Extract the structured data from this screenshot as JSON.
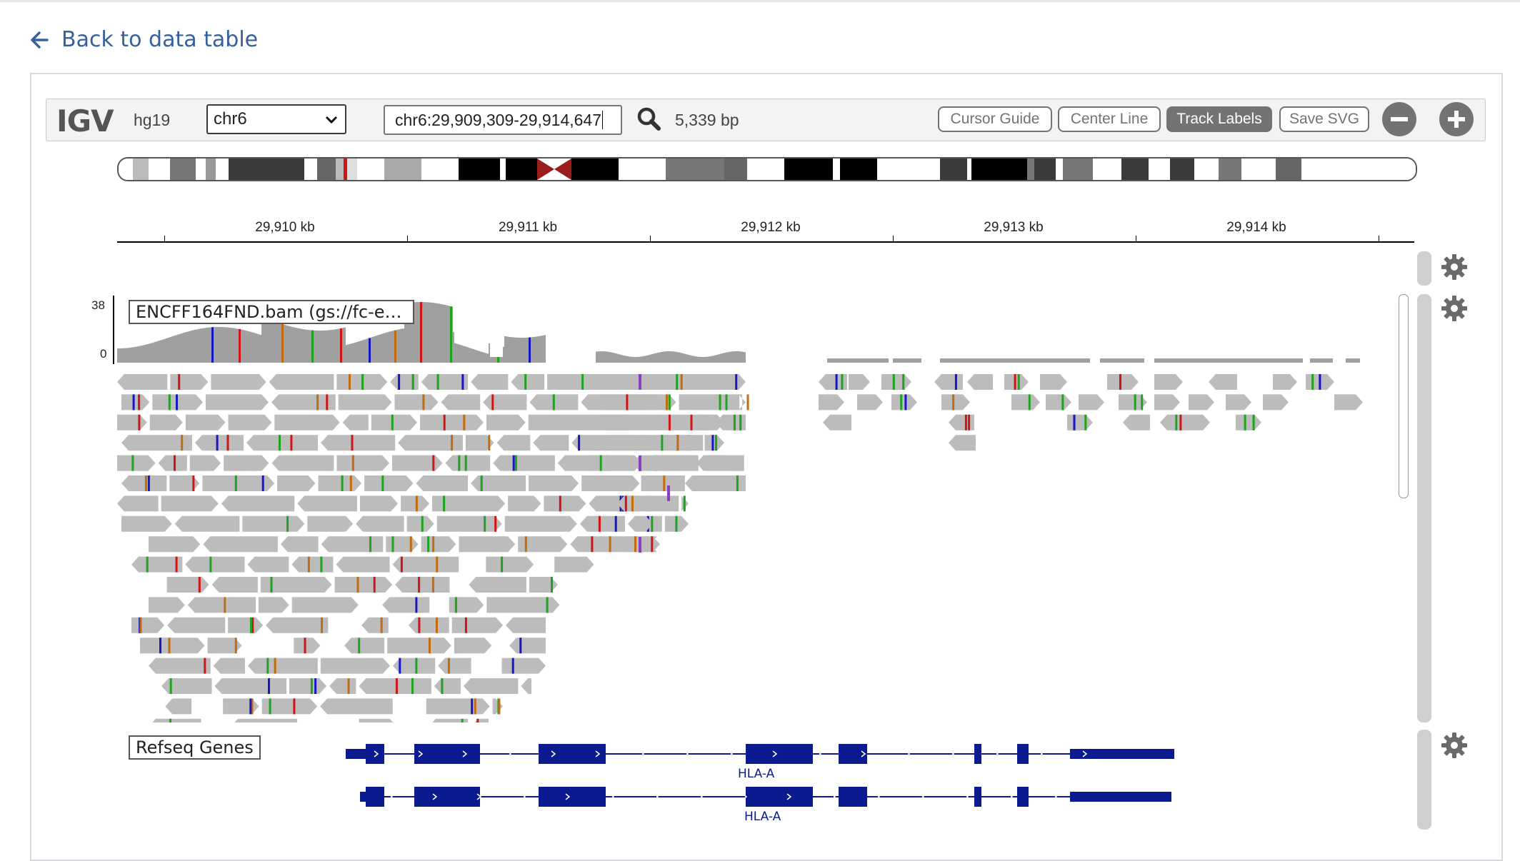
{
  "back_link": {
    "label": "Back to data table"
  },
  "navbar": {
    "logo": "IGV",
    "genome": "hg19",
    "chromosome": "chr6",
    "locus": "chr6:29,909,309-29,914,647",
    "bp_count": "5,339 bp",
    "buttons": {
      "cursor_guide": "Cursor Guide",
      "center_line": "Center Line",
      "track_labels": "Track Labels",
      "save_svg": "Save SVG"
    },
    "icons": {
      "search": "search-icon",
      "zoom_out": "minus-circle-icon",
      "zoom_in": "plus-circle-icon"
    }
  },
  "ruler": {
    "ticks": [
      "29,910 kb",
      "29,911 kb",
      "29,912 kb",
      "29,913 kb",
      "29,914 kb"
    ]
  },
  "alignment_track": {
    "name": "ENCFF164FND.bam (gs://fc-e…",
    "coverage_max": "38",
    "coverage_min": "0"
  },
  "gene_track": {
    "name": "Refseq Genes",
    "genes": [
      "HLA-A",
      "HLA-A"
    ]
  },
  "colors": {
    "read": "#bcbcbc",
    "coverage": "#a0a0a0",
    "mismatch_A": "#1ea31e",
    "mismatch_C": "#1518c2",
    "mismatch_G": "#c36b10",
    "mismatch_T": "#d11414",
    "insertion": "#8a3fc2",
    "gene": "#0b1a8f",
    "centromere": "#9b1c1c"
  }
}
